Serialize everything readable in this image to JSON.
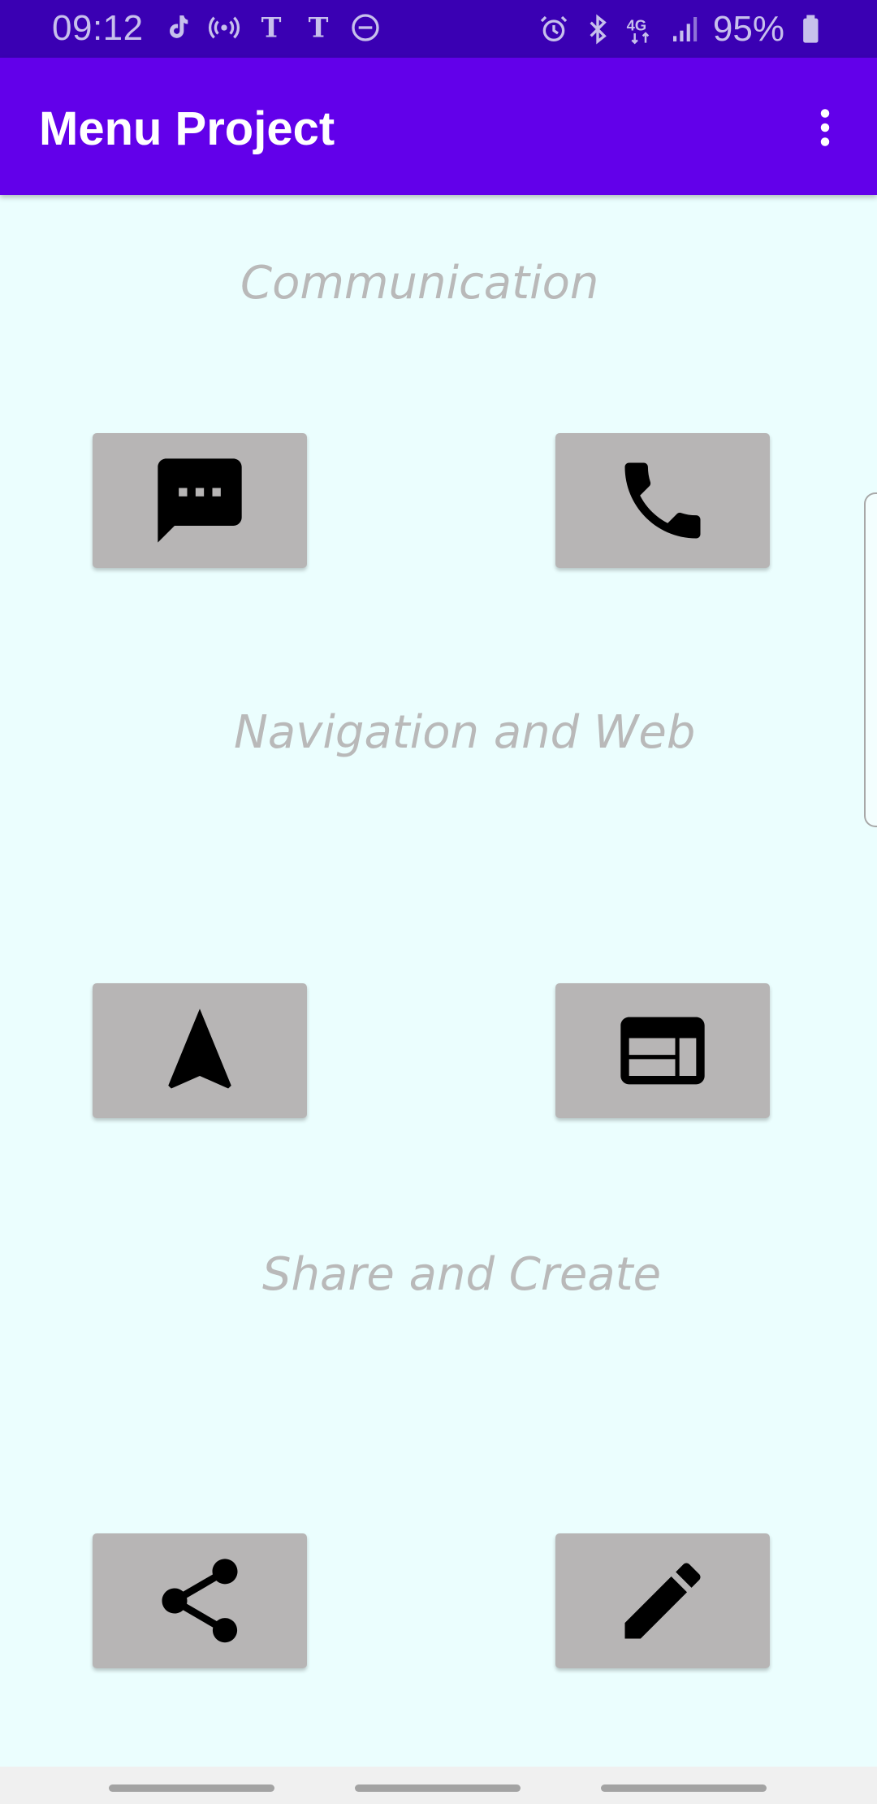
{
  "status_bar": {
    "time": "09:12",
    "battery_text": "95%",
    "left_icons": [
      "tiktok-icon",
      "cast-icon",
      "nyt-icon",
      "nyt-icon",
      "do-not-disturb-icon"
    ],
    "right_icons": [
      "alarm-icon",
      "bluetooth-icon",
      "4g-lte-icon",
      "signal-icon",
      "battery-icon"
    ]
  },
  "app_bar": {
    "title": "Menu Project",
    "menu_icon": "more-vert-icon"
  },
  "sections": [
    {
      "title": "Communication",
      "buttons": [
        {
          "icon": "message-icon"
        },
        {
          "icon": "phone-icon"
        }
      ]
    },
    {
      "title": "Navigation and Web",
      "buttons": [
        {
          "icon": "navigation-icon"
        },
        {
          "icon": "web-icon"
        }
      ]
    },
    {
      "title": "Share and Create",
      "buttons": [
        {
          "icon": "share-icon"
        },
        {
          "icon": "edit-icon"
        }
      ]
    }
  ],
  "colors": {
    "status_bar": "#3a00b3",
    "app_bar": "#6200ea",
    "background": "#ebfefe",
    "button": "#b7b5b5",
    "section_text": "#b9b9b9"
  }
}
